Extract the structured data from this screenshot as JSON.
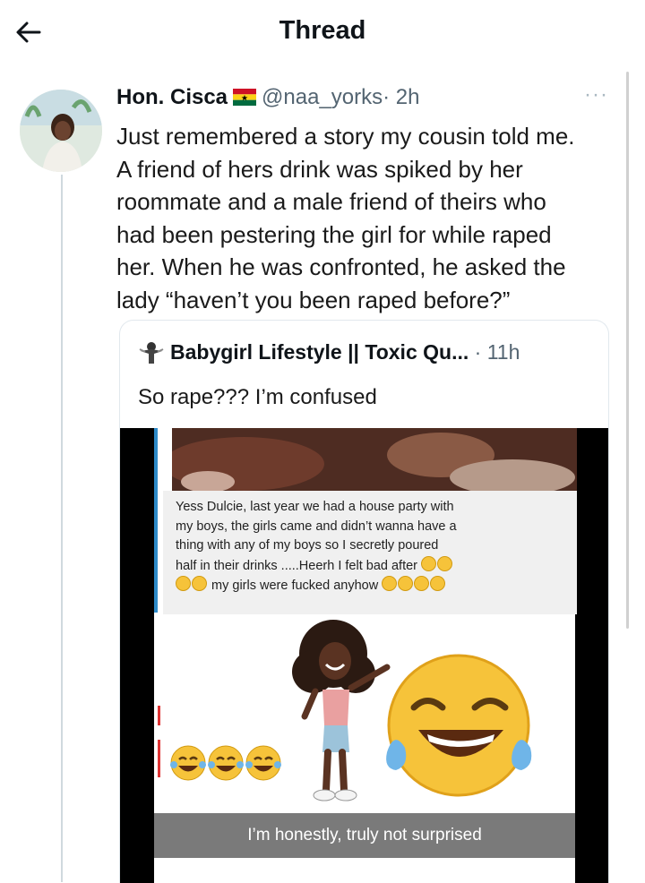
{
  "header": {
    "title": "Thread",
    "back_icon": "arrow-left-icon"
  },
  "tweet": {
    "name": "Hon. Cisca",
    "flag_icon": "ghana-flag-icon",
    "handle": "@naa_yorks",
    "time": "· 2h",
    "more_label": "···",
    "lines": [
      "Just remembered a story my cousin told me.",
      "A friend of hers drink was spiked by her",
      "roommate and a male friend of theirs who",
      "had been pestering the girl for while raped",
      "her. When he was confronted, he asked the",
      "lady “haven’t you been raped before?”"
    ]
  },
  "quoted": {
    "name": "Babygirl Lifestyle || Toxic Qu...",
    "time": " · 11h",
    "text": "So rape??? I’m confused",
    "chat_lines": [
      "Yess Dulcie, last year we had a house party with",
      "my boys, the girls came and didn’t wanna have a",
      "thing with any of my boys so I secretly poured",
      "half in their drinks .....Heerh I felt bad after",
      "my girls were fucked anyhow"
    ],
    "caption": "I’m honestly, truly not surprised"
  },
  "colors": {
    "accent_blue": "#2e8bc9",
    "emoji_yellow": "#f6c33a",
    "text_secondary": "#536471"
  }
}
